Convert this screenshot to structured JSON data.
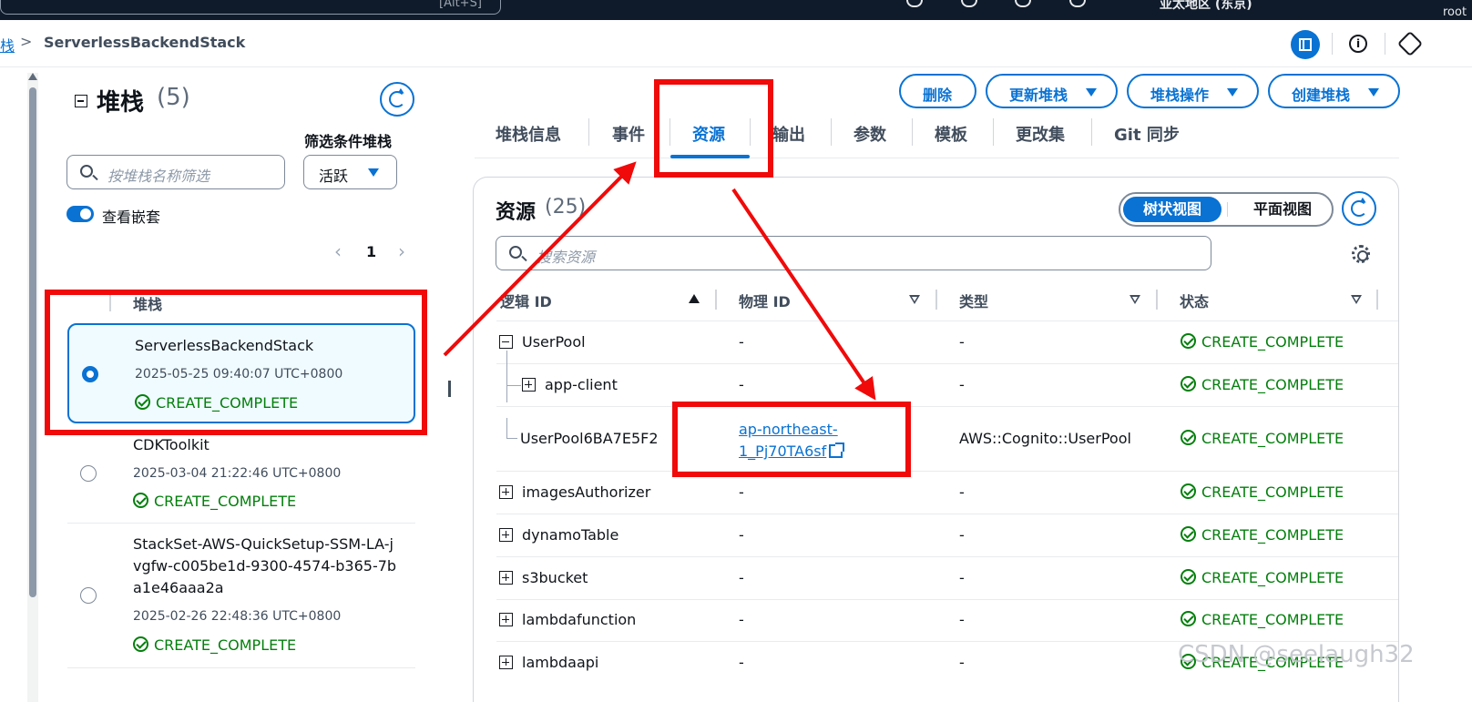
{
  "topbar": {
    "shortcut": "[Alt+S]",
    "region": "亚太地区 (东京)",
    "user": "root"
  },
  "breadcrumb": {
    "prev": "栈",
    "current": "ServerlessBackendStack"
  },
  "left_panel": {
    "title": "堆栈",
    "count": "(5)",
    "filter_label": "筛选条件堆栈",
    "search_placeholder": "按堆栈名称筛选",
    "filter_value": "活跃",
    "toggle_label": "查看嵌套",
    "page": "1",
    "column_header": "堆栈",
    "stacks": [
      {
        "name": "ServerlessBackendStack",
        "date": "2025-05-25 09:40:07 UTC+0800",
        "status": "CREATE_COMPLETE",
        "selected": true
      },
      {
        "name": "CDKToolkit",
        "date": "2025-03-04 21:22:46 UTC+0800",
        "status": "CREATE_COMPLETE",
        "selected": false
      },
      {
        "name": "StackSet-AWS-QuickSetup-SSM-LA-jvgfw-c005be1d-9300-4574-b365-7ba1e46aaa2a",
        "date": "2025-02-26 22:48:36 UTC+0800",
        "status": "CREATE_COMPLETE",
        "selected": false
      }
    ]
  },
  "actions": {
    "delete": "删除",
    "update": "更新堆栈",
    "stack_actions": "堆栈操作",
    "create": "创建堆栈"
  },
  "tabs": [
    "堆栈信息",
    "事件",
    "资源",
    "输出",
    "参数",
    "模板",
    "更改集",
    "Git 同步"
  ],
  "active_tab": "资源",
  "resources": {
    "title": "资源",
    "count": "(25)",
    "view_tree": "树状视图",
    "view_flat": "平面视图",
    "search_placeholder": "搜索资源",
    "columns": [
      "逻辑 ID",
      "物理 ID",
      "类型",
      "状态"
    ],
    "rows": [
      {
        "logical": "UserPool",
        "physical": "-",
        "type": "-",
        "status": "CREATE_COMPLETE",
        "expander": "minus"
      },
      {
        "logical": "app-client",
        "physical": "-",
        "type": "-",
        "status": "CREATE_COMPLETE",
        "expander": "plus"
      },
      {
        "logical": "UserPool6BA7E5F2",
        "physical_line1": "ap-northeast-",
        "physical_line2": "1_Pj70TA6sf",
        "type": "AWS::Cognito::UserPool",
        "status": "CREATE_COMPLETE",
        "expander": "none"
      },
      {
        "logical": "imagesAuthorizer",
        "physical": "-",
        "type": "-",
        "status": "CREATE_COMPLETE",
        "expander": "plus"
      },
      {
        "logical": "dynamoTable",
        "physical": "-",
        "type": "-",
        "status": "CREATE_COMPLETE",
        "expander": "plus"
      },
      {
        "logical": "s3bucket",
        "physical": "-",
        "type": "-",
        "status": "CREATE_COMPLETE",
        "expander": "plus"
      },
      {
        "logical": "lambdafunction",
        "physical": "-",
        "type": "-",
        "status": "CREATE_COMPLETE",
        "expander": "plus"
      },
      {
        "logical": "lambdaapi",
        "physical": "-",
        "type": "-",
        "status": "CREATE_COMPLETE",
        "expander": "plus"
      }
    ]
  },
  "watermark": "CSDN @seelaugh32",
  "colors": {
    "accent": "#0972d3",
    "success": "#037f0c",
    "annotation": "#f00a0a",
    "topbar": "#0f1b2a"
  }
}
